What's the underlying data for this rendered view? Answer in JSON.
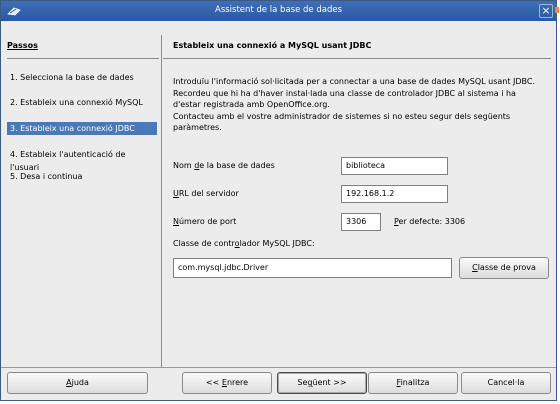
{
  "window": {
    "title": "Assistent de la base de dades",
    "close_glyph": "×",
    "app_icon": "database-icon"
  },
  "sidebar": {
    "heading": "Passos",
    "steps": [
      {
        "label": "1. Selecciona la base de dades",
        "active": false
      },
      {
        "label": "2. Estableix una connexió MySQL",
        "active": false
      },
      {
        "label": "3. Estableix una connexió JDBC",
        "active": true
      },
      {
        "label": "4. Estableix l'autenticació de l'usuari",
        "active": false
      },
      {
        "label": "5. Desa i continua",
        "active": false
      }
    ]
  },
  "main": {
    "heading": "Estableix una connexió a MySQL usant JDBC",
    "description": "Introduïu l'informació sol·licitada per a connectar a una base de dades MySQL usant JDBC.\nRecordeu que hi ha d'haver instal·lada una classe de controlador JDBC al sistema i ha d'estar registrada amb OpenOffice.org.\nContacteu amb el vostre administrador de sistemes si no esteu segur dels següents paràmetres.",
    "db_name": {
      "label_pre": "Nom ",
      "label_key": "d",
      "label_post": "e la base de dades",
      "value": "biblioteca"
    },
    "server_url": {
      "label_key": "U",
      "label_post": "RL del servidor",
      "value": "192.168.1.2"
    },
    "port": {
      "label_key": "N",
      "label_post": "úmero de port",
      "value": "3306",
      "default_key": "P",
      "default_post": "er defecte: 3306"
    },
    "driver_class": {
      "label_pre": "Classe de contr",
      "label_key": "o",
      "label_post": "lador MySQL JDBC:",
      "value": "com.mysql.jdbc.Driver"
    },
    "test_button": {
      "key": "C",
      "post": "lasse de prova"
    }
  },
  "buttons": {
    "help": {
      "key": "A",
      "post": "juda"
    },
    "back": {
      "pre": "<< ",
      "key": "E",
      "post": "nrere"
    },
    "next": {
      "pre": "Se",
      "key": "g",
      "post": "üent >>"
    },
    "finish": {
      "key": "F",
      "post": "inalitza"
    },
    "cancel": {
      "label": "Cancel·la"
    }
  }
}
